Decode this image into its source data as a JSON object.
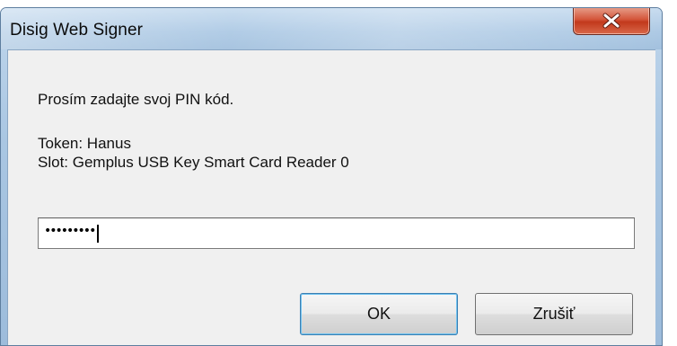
{
  "window": {
    "title": "Disig Web Signer"
  },
  "dialog": {
    "prompt": "Prosím zadajte svoj PIN kód.",
    "token_line": "Token: Hanus",
    "slot_line": "Slot: Gemplus USB Key Smart Card Reader 0",
    "pin_field": {
      "masked_value": "•••••••••",
      "masked_length": 9
    },
    "buttons": {
      "ok": "OK",
      "cancel": "Zrušiť"
    }
  },
  "icons": {
    "close": "close-icon"
  },
  "colors": {
    "title_bar": "#aecae5",
    "close_button": "#c2391c",
    "dialog_background": "#f0f0f0",
    "default_button_border": "#3c7fb1"
  }
}
